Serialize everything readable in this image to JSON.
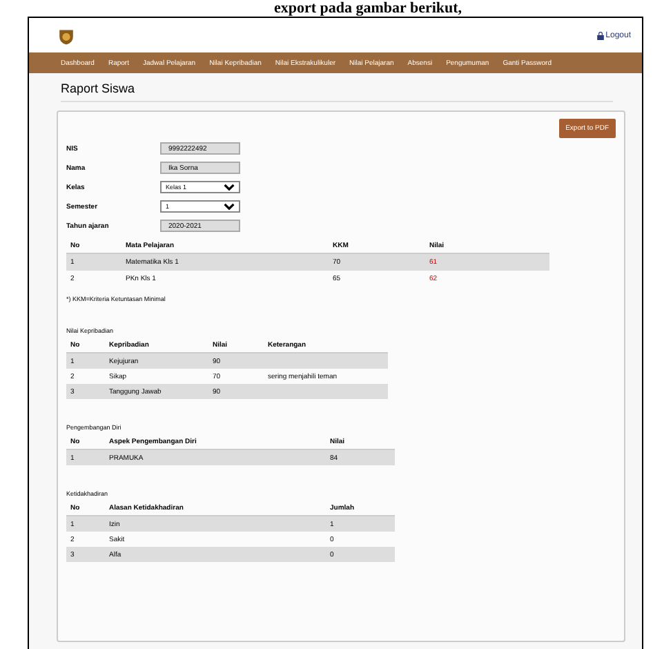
{
  "caption": "export pada gambar berikut,",
  "header": {
    "logout": "Logout"
  },
  "nav": [
    {
      "label": "Dashboard"
    },
    {
      "label": "Raport"
    },
    {
      "label": "Jadwal Pelajaran"
    },
    {
      "label": "Nilai Kepribadian"
    },
    {
      "label": "Nilai Ekstrakulikuler"
    },
    {
      "label": "Nilai Pelajaran"
    },
    {
      "label": "Absensi"
    },
    {
      "label": "Pengumuman"
    },
    {
      "label": "Ganti Password"
    }
  ],
  "page_title": "Raport Siswa",
  "export_button": "Export to PDF",
  "form": [
    {
      "label": "NIS",
      "kind": "text",
      "value": "9992222492"
    },
    {
      "label": "Nama",
      "kind": "text",
      "value": "Ika Sorna"
    },
    {
      "label": "Kelas",
      "kind": "select",
      "value": "Kelas 1"
    },
    {
      "label": "Semester",
      "kind": "select",
      "value": "1"
    },
    {
      "label": "Tahun ajaran",
      "kind": "text",
      "value": "2020-2021"
    }
  ],
  "grades": {
    "columns": [
      "No",
      "Mata Pelajaran",
      "KKM",
      "Nilai"
    ],
    "rows": [
      [
        "1",
        "Matematika Kls 1",
        "70",
        "61"
      ],
      [
        "2",
        "PKn Kls 1",
        "65",
        "62"
      ]
    ],
    "note": "*) KKM=Kriteria Ketuntasan Minimal"
  },
  "sections": [
    {
      "title": "Nilai Kepribadian",
      "columns": [
        "No",
        "Kepribadian",
        "Nilai",
        "Keterangan"
      ],
      "rows": [
        [
          "1",
          "Kejujuran",
          "90",
          ""
        ],
        [
          "2",
          "Sikap",
          "70",
          "sering menjahili teman"
        ],
        [
          "3",
          "Tanggung Jawab",
          "90",
          ""
        ]
      ]
    },
    {
      "title": "Pengembangan Diri",
      "columns": [
        "No",
        "Aspek Pengembangan Diri",
        "Nilai"
      ],
      "rows": [
        [
          "1",
          "PRAMUKA",
          "84"
        ]
      ]
    },
    {
      "title": "Ketidakhadiran",
      "columns": [
        "No",
        "Alasan Ketidakhadiran",
        "Jumlah"
      ],
      "rows": [
        [
          "1",
          "Izin",
          "1"
        ],
        [
          "2",
          "Sakit",
          "0"
        ],
        [
          "3",
          "Alfa",
          "0"
        ]
      ]
    }
  ]
}
